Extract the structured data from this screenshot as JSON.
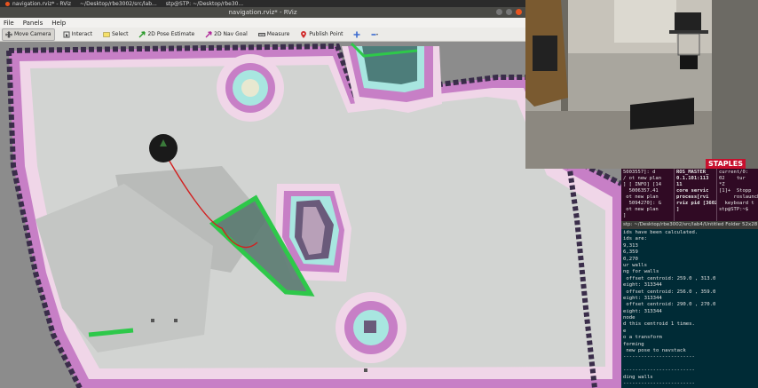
{
  "taskbar": {
    "items": [
      {
        "label": "navigation.rviz* - RViz"
      },
      {
        "label": "~/Desktop/rbe3002/src/lab..."
      },
      {
        "label": "stp@STP: ~/Desktop/rbe30..."
      }
    ]
  },
  "window": {
    "title": "navigation.rviz* - RViz"
  },
  "menu": {
    "items": [
      {
        "label": "File"
      },
      {
        "label": "Panels"
      },
      {
        "label": "Help"
      }
    ]
  },
  "toolbar": {
    "tools": [
      {
        "label": "Move Camera",
        "icon": "move-camera-icon",
        "active": true
      },
      {
        "label": "Interact",
        "icon": "interact-icon"
      },
      {
        "label": "Select",
        "icon": "select-icon"
      },
      {
        "label": "2D Pose Estimate",
        "icon": "pose-estimate-icon"
      },
      {
        "label": "2D Nav Goal",
        "icon": "nav-goal-icon"
      },
      {
        "label": "Measure",
        "icon": "measure-icon"
      },
      {
        "label": "Publish Point",
        "icon": "publish-point-icon"
      }
    ]
  },
  "camera_feed": {
    "sign": "STAPLES"
  },
  "terminal_top": {
    "columns": [
      {
        "lines": [
          "5003557]: d",
          "/ ot new plan",
          "] [ INFO] [14",
          "  5006357.41",
          " ot new plan",
          "  5094270]: G",
          " ot new plan",
          "]"
        ]
      },
      {
        "lines": [
          "ROS_MASTER_",
          "0.1.101:113",
          "11",
          "",
          "core servic",
          "process[rvi",
          "rviz pid [3602",
          "]"
        ]
      },
      {
        "lines": [
          "current/0:",
          "02    tur",
          "*Z",
          "[1]+  Stopp",
          "     roslaunch",
          "  keyboard t",
          "stp@STP:~$",
          ""
        ]
      }
    ]
  },
  "terminal_bottom": {
    "title": "stp: ~/Desktop/rbe3002/src/lab4/Untitled Folder 52x28",
    "lines": [
      "ids have been calculated.",
      "ids are:",
      "9,313",
      "6,359",
      "0,270",
      "ur walls",
      "ng for walls",
      " offset centroid: 259.0 , 313.0",
      "eight: 313344",
      " offset centroid: 256.0 , 359.0",
      "eight: 313344",
      " offset centroid: 290.0 , 270.0",
      "eight: 313344",
      "node",
      "d this centroid 1 times.",
      "e",
      "o a transform",
      "forming",
      " new pose to navstack",
      "------------------------",
      "",
      "------------------------",
      "ding walls",
      "------------------------"
    ]
  },
  "colors": {
    "free": "#d2d4d2",
    "unknown": "#9e9e9e",
    "wall": "#3a2d4a",
    "inflation": "#c77fc6",
    "halo": "#f0d6e8",
    "cyan": "#a8e6e0",
    "frontier": "#2ec84a",
    "path": "#d22020",
    "robot": "#1a1a1a"
  }
}
